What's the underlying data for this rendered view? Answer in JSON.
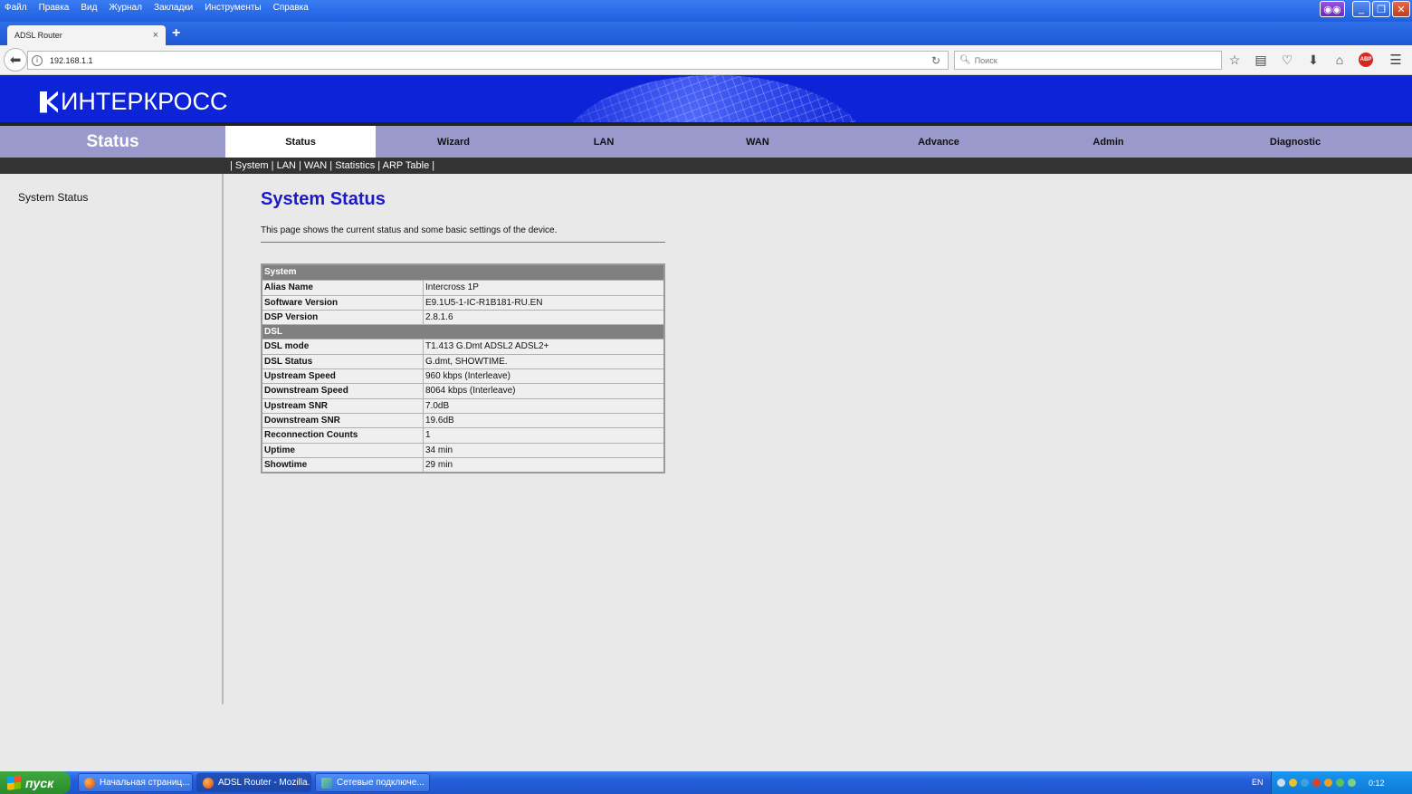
{
  "browser": {
    "menu": [
      "Файл",
      "Правка",
      "Вид",
      "Журнал",
      "Закладки",
      "Инструменты",
      "Справка"
    ],
    "tab_title": "ADSL Router",
    "tab_close": "×",
    "new_tab": "+",
    "url": "192.168.1.1",
    "search_placeholder": "Поиск"
  },
  "router": {
    "logo_text": "ИНТЕРКРОСС",
    "section_title": "Status",
    "nav_tabs": [
      "Status",
      "Wizard",
      "LAN",
      "WAN",
      "Advance",
      "Admin",
      "Diagnostic"
    ],
    "subnav": [
      "System",
      "LAN",
      "WAN",
      "Statistics",
      "ARP Table"
    ],
    "sidebar_items": [
      "System Status"
    ],
    "page_title": "System Status",
    "page_description": "This page shows the current status and some basic settings of the device.",
    "status_table": [
      {
        "type": "header",
        "label": "System"
      },
      {
        "label": "Alias Name",
        "value": "Intercross 1P"
      },
      {
        "label": "Software Version",
        "value": "E9.1U5-1-IC-R1B181-RU.EN"
      },
      {
        "label": "DSP Version",
        "value": "2.8.1.6"
      },
      {
        "type": "header",
        "label": "DSL"
      },
      {
        "label": "DSL mode",
        "value": "T1.413 G.Dmt ADSL2 ADSL2+"
      },
      {
        "label": "DSL Status",
        "value": "G.dmt, SHOWTIME."
      },
      {
        "label": "Upstream Speed",
        "value": "960 kbps  (Interleave)"
      },
      {
        "label": "Downstream Speed",
        "value": "8064 kbps  (Interleave)"
      },
      {
        "label": "Upstream SNR",
        "value": "7.0dB"
      },
      {
        "label": "Downstream SNR",
        "value": "19.6dB"
      },
      {
        "label": "Reconnection Counts",
        "value": "1"
      },
      {
        "label": "Uptime",
        "value": "34 min"
      },
      {
        "label": "Showtime",
        "value": "29 min"
      }
    ]
  },
  "taskbar": {
    "start_label": "пуск",
    "tasks": [
      "Начальная страниц...",
      "ADSL Router - Mozilla...",
      "Сетевые подключе..."
    ],
    "language": "EN",
    "clock": "0:12"
  },
  "colors": {
    "banner": "#0d23d8",
    "nav": "#9999cc",
    "title": "#1a1ac8",
    "table_header": "#808080"
  }
}
